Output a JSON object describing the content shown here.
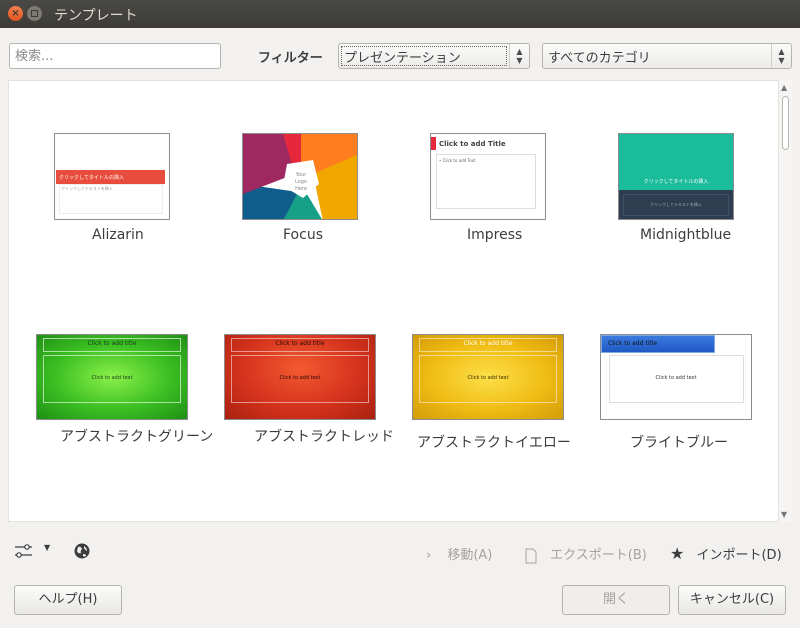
{
  "window": {
    "title": "テンプレート"
  },
  "toolbar": {
    "search_placeholder": "検索...",
    "filter_label": "フィルター",
    "filter_value": "プレゼンテーション",
    "category_value": "すべてのカテゴリ"
  },
  "templates": [
    {
      "name": "Alizarin",
      "title_text": "クリックしてタイトルの挿入",
      "sub_text": "クリックしてテキストを挿入"
    },
    {
      "name": "Focus",
      "logo_text": "Your Logo Here"
    },
    {
      "name": "Impress",
      "title_text": "Click to add Title",
      "body_text": "• Click to add Text"
    },
    {
      "name": "Midnightblue",
      "title_text": "クリックしてタイトルの挿入",
      "sub_text": "クリックしてテキストを挿入"
    },
    {
      "name": "アブストラクトグリーン",
      "title_text": "Click to add title",
      "body_text": "Click to add text"
    },
    {
      "name": "アブストラクトレッド",
      "title_text": "Click to add title",
      "body_text": "Click to add text"
    },
    {
      "name": "アブストラクトイエロー",
      "title_text": "Click to add title",
      "body_text": "Click to add text"
    },
    {
      "name": "ブライトブルー",
      "title_text": "Click to add title",
      "body_text": "Click to add text"
    }
  ],
  "actions": {
    "move": "移動(A)",
    "export": "エクスポート(B)",
    "import": "インポート(D)"
  },
  "buttons": {
    "help": "ヘルプ(H)",
    "open": "開く",
    "cancel": "キャンセル(C)"
  }
}
